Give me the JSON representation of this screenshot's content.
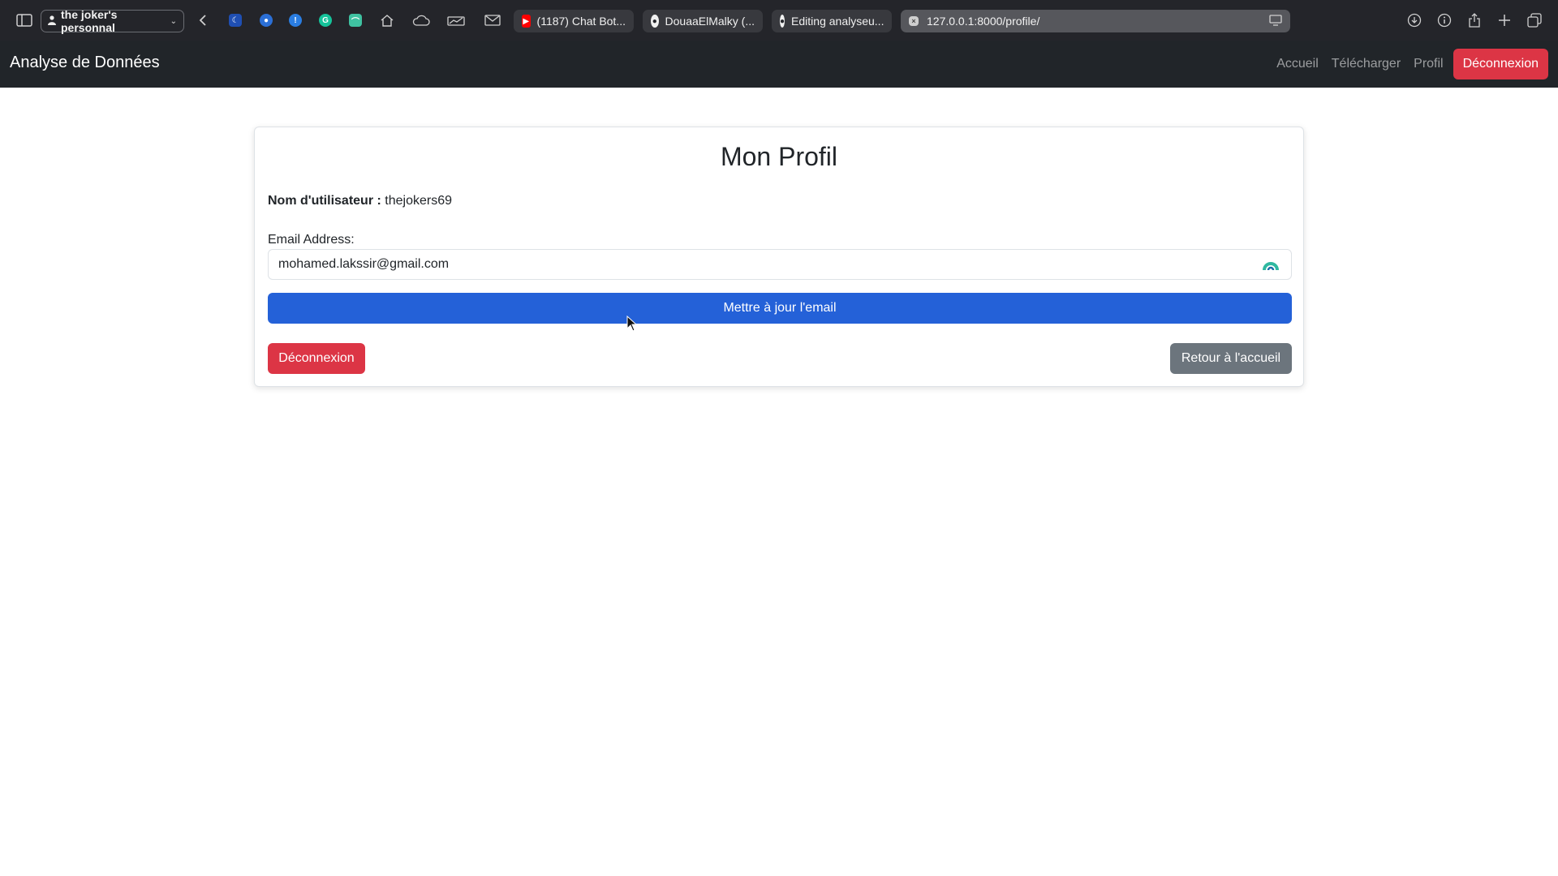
{
  "browser": {
    "profile_label": "the joker's personnal",
    "tabs": [
      {
        "title": "(1187) Chat Bot...",
        "icon": "youtube-icon"
      },
      {
        "title": "DouaaElMalky (...",
        "icon": "github-icon"
      },
      {
        "title": "Editing analyseu...",
        "icon": "github-icon"
      }
    ],
    "url": "127.0.0.1:8000/profile/",
    "colors": {
      "toolbar": "#24252a",
      "youtube": "#ff0000"
    }
  },
  "navbar": {
    "brand": "Analyse de Données",
    "links": [
      "Accueil",
      "Télécharger",
      "Profil"
    ],
    "logout_label": "Déconnexion"
  },
  "profile": {
    "title": "Mon Profil",
    "username_label": "Nom d'utilisateur :",
    "username_value": "thejokers69",
    "email_label": "Email Address:",
    "email_value": "mohamed.lakssir@gmail.com",
    "update_button": "Mettre à jour l'email",
    "logout_button": "Déconnexion",
    "home_button": "Retour à l'accueil"
  },
  "colors": {
    "navbar_bg": "#212529",
    "primary": "#2461d8",
    "danger": "#dc3545",
    "secondary": "#6c757d"
  }
}
